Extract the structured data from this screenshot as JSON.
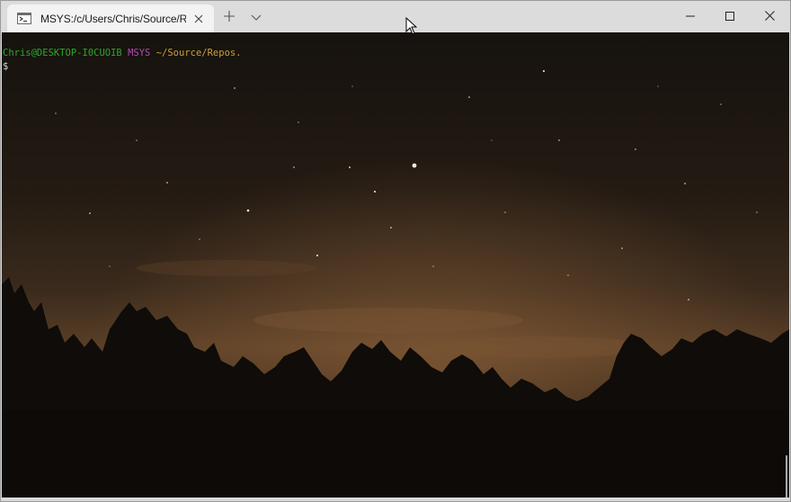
{
  "window": {
    "tab": {
      "title": "MSYS:/c/Users/Chris/Source/Repos",
      "icon": "terminal-icon"
    },
    "new_tab_icon": "plus-icon",
    "dropdown_icon": "chevron-down-icon",
    "controls": [
      "minimize-icon",
      "maximize-icon",
      "close-icon"
    ]
  },
  "terminal": {
    "prompt_user": "Chris@DESKTOP-I0CUOIB",
    "prompt_env": "MSYS",
    "prompt_path": "~/Source/Repos.",
    "prompt_symbol": "$",
    "background": "starry-night-image"
  },
  "colors": {
    "prompt_user": "#2aa82a",
    "prompt_env": "#b04ab0",
    "prompt_path": "#c7a13a"
  }
}
